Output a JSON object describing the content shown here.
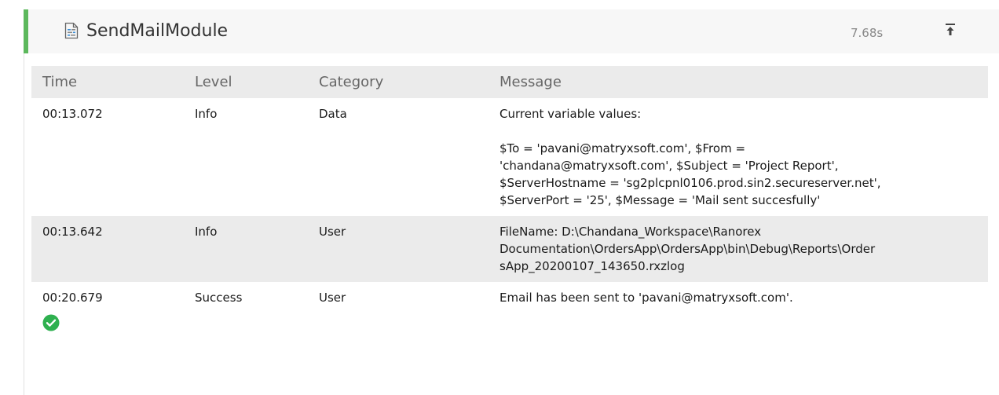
{
  "module": {
    "title": "SendMailModule",
    "duration": "7.68s",
    "accent_color": "#5cb85c",
    "icons": {
      "module": "document-icon",
      "collapse": "collapse-to-top-icon",
      "success": "check-circle-icon"
    }
  },
  "table": {
    "headers": {
      "time": "Time",
      "level": "Level",
      "category": "Category",
      "message": "Message"
    },
    "rows": [
      {
        "time": "00:13.072",
        "level": "Info",
        "category": "Data",
        "message_intro": "Current variable values:",
        "message_lines": [
          "$To = 'pavani@matryxsoft.com', $From =",
          "'chandana@matryxsoft.com', $Subject = 'Project Report',",
          "$ServerHostname = 'sg2plcpnl0106.prod.sin2.secureserver.net',",
          "$ServerPort = '25', $Message = 'Mail sent succesfully'"
        ]
      },
      {
        "time": "00:13.642",
        "level": "Info",
        "category": "User",
        "message_lines": [
          "FileName: D:\\Chandana_Workspace\\Ranorex",
          "Documentation\\OrdersApp\\OrdersApp\\bin\\Debug\\Reports\\Order",
          "sApp_20200107_143650.rxzlog"
        ]
      },
      {
        "time": "00:20.679",
        "level": "Success",
        "category": "User",
        "message": "Email has been sent to 'pavani@matryxsoft.com'.",
        "status_color": "#2eb04f"
      }
    ]
  }
}
